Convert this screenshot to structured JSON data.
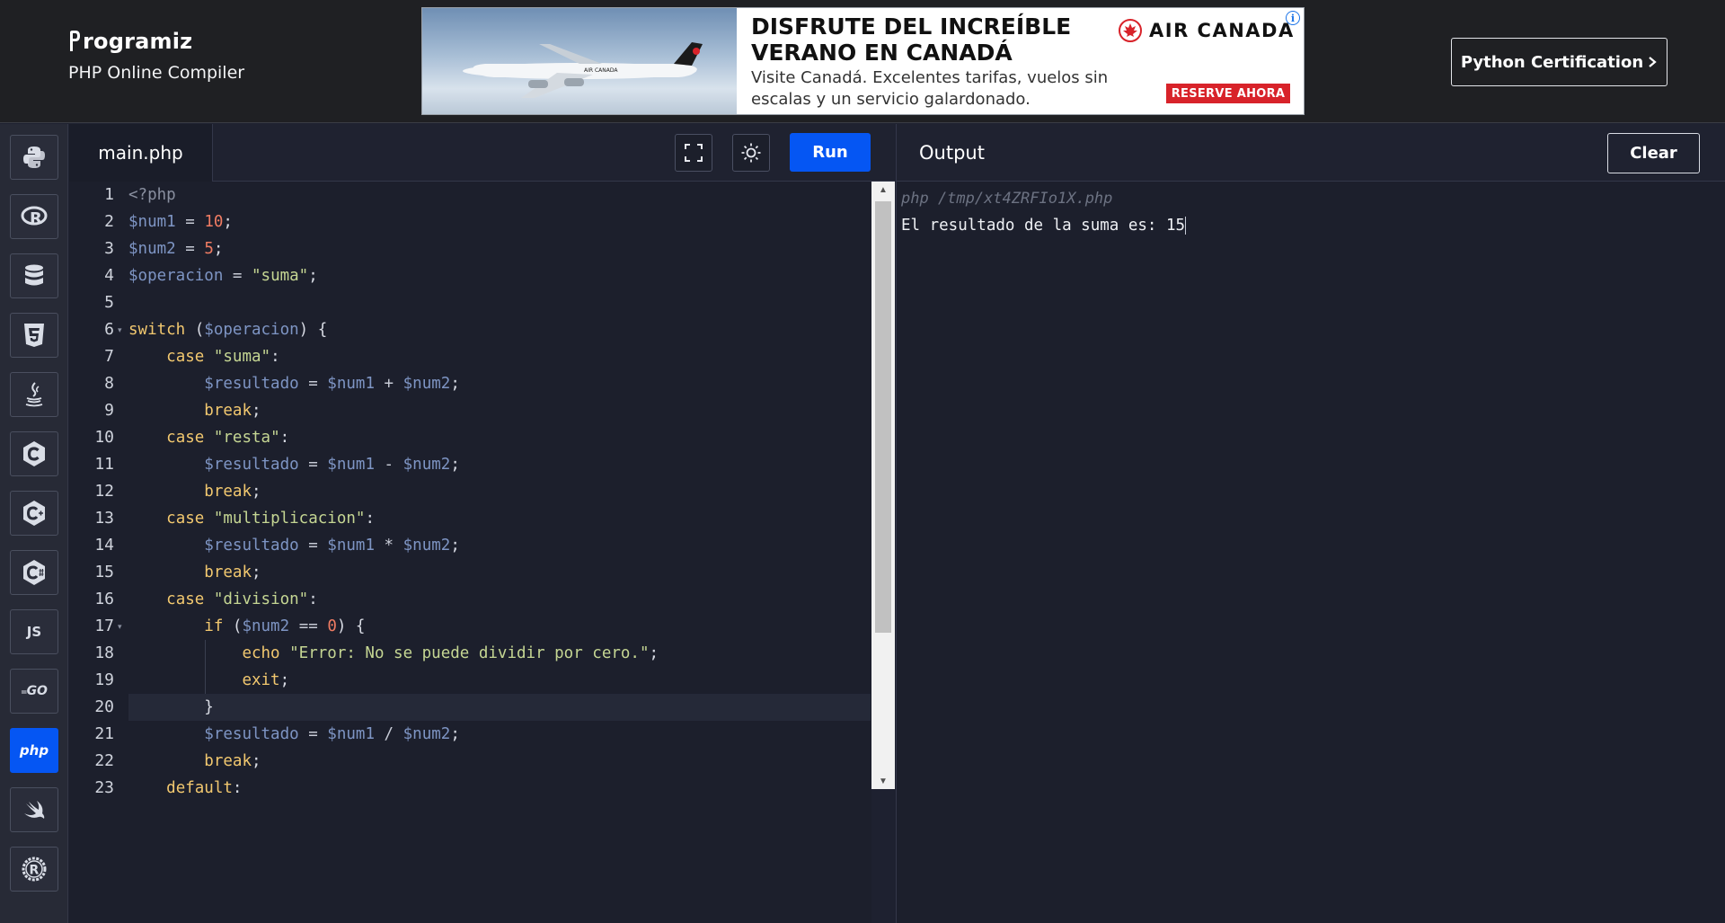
{
  "header": {
    "logo_text": "rogramiz",
    "subtitle": "PHP Online Compiler",
    "cert_button": "Python Certification"
  },
  "ad": {
    "headline": "DISFRUTE DEL INCREÍBLE VERANO EN CANADÁ",
    "body": "Visite Canadá. Excelentes tarifas, vuelos sin escalas y un servicio galardonado.",
    "brand": "AIR CANADA",
    "cta": "RESERVE AHORA",
    "plane_livery": "AIR CANADA"
  },
  "sidebar": {
    "items": [
      {
        "name": "python",
        "icon": "python-icon"
      },
      {
        "name": "r",
        "icon": "r-icon"
      },
      {
        "name": "sql",
        "icon": "database-icon"
      },
      {
        "name": "html",
        "icon": "html5-icon"
      },
      {
        "name": "java",
        "icon": "java-icon"
      },
      {
        "name": "c",
        "icon": "c-icon"
      },
      {
        "name": "cpp",
        "icon": "cpp-icon"
      },
      {
        "name": "csharp",
        "icon": "csharp-icon"
      },
      {
        "name": "js",
        "label": "JS"
      },
      {
        "name": "go",
        "label": "GO"
      },
      {
        "name": "php",
        "label": "php",
        "active": true
      },
      {
        "name": "swift",
        "icon": "swift-icon"
      },
      {
        "name": "rust",
        "icon": "rust-icon"
      }
    ]
  },
  "editor": {
    "tab": "main.php",
    "run_label": "Run",
    "lines": [
      "<?php",
      "$num1 = 10;",
      "$num2 = 5;",
      "$operacion = \"suma\";",
      "",
      "switch ($operacion) {",
      "    case \"suma\":",
      "        $resultado = $num1 + $num2;",
      "        break;",
      "    case \"resta\":",
      "        $resultado = $num1 - $num2;",
      "        break;",
      "    case \"multiplicacion\":",
      "        $resultado = $num1 * $num2;",
      "        break;",
      "    case \"division\":",
      "        if ($num2 == 0) {",
      "            echo \"Error: No se puede dividir por cero.\";",
      "            exit;",
      "        }",
      "        $resultado = $num1 / $num2;",
      "        break;",
      "    default:"
    ]
  },
  "output": {
    "title": "Output",
    "clear_label": "Clear",
    "command": "php /tmp/xt4ZRFIo1X.php",
    "text": "El resultado de la suma es: 15"
  },
  "colors": {
    "accent": "#0556f3",
    "background": "#1c1f2c",
    "header": "#1f2023"
  }
}
